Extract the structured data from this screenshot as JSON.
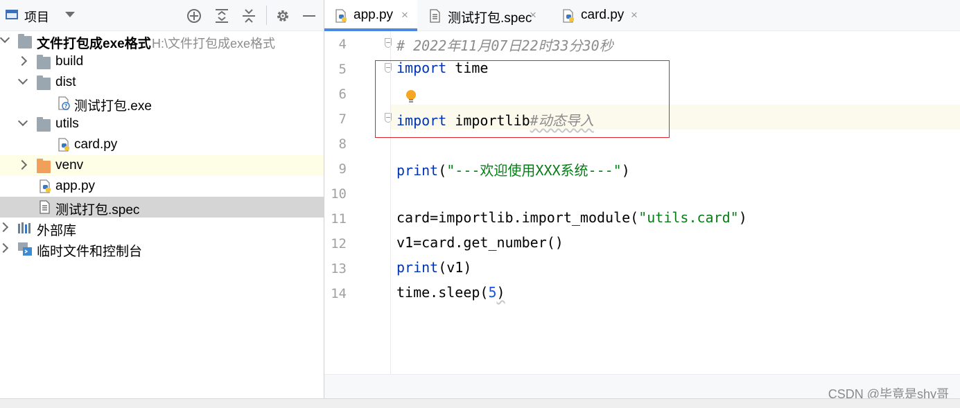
{
  "project_panel": {
    "title": "项目",
    "header_icons": [
      "crosshair-icon",
      "expand-all-icon",
      "collapse-all-icon",
      "gear-icon",
      "minimize-icon"
    ],
    "tree": [
      {
        "label": "文件打包成exe格式",
        "path": "H:\\文件打包成exe格式",
        "type": "root-folder",
        "expanded": true
      },
      {
        "label": "build",
        "type": "folder",
        "expanded": false
      },
      {
        "label": "dist",
        "type": "folder",
        "expanded": true
      },
      {
        "label": "测试打包.exe",
        "type": "exe-file"
      },
      {
        "label": "utils",
        "type": "folder",
        "expanded": true
      },
      {
        "label": "card.py",
        "type": "python-file"
      },
      {
        "label": "venv",
        "type": "folder-orange",
        "expanded": false
      },
      {
        "label": "app.py",
        "type": "python-file"
      },
      {
        "label": "测试打包.spec",
        "type": "text-file",
        "selected": true
      },
      {
        "label": "外部库",
        "type": "external-libs",
        "expanded": false
      },
      {
        "label": "临时文件和控制台",
        "type": "scratches",
        "expanded": false
      }
    ]
  },
  "editor": {
    "tabs": [
      {
        "label": "app.py",
        "active": true,
        "icon": "python-file-icon"
      },
      {
        "label": "测试打包.spec",
        "active": false,
        "icon": "text-file-icon"
      },
      {
        "label": "card.py",
        "active": false,
        "icon": "python-file-icon"
      }
    ],
    "close_glyph": "×",
    "line_numbers": [
      "4",
      "5",
      "6",
      "7",
      "8",
      "9",
      "10",
      "11",
      "12",
      "13",
      "14"
    ],
    "code": {
      "l4": "# 2022年11月07日22时33分30秒",
      "l5_kw": "import",
      "l5_rest": " time",
      "l7_kw": "import",
      "l7_rest": " importlib",
      "l7_cmt": "#动态导入",
      "l9_kw": "print",
      "l9_open": "(",
      "l9_str": "\"---欢迎使用XXX系统---\"",
      "l9_close": ")",
      "l11_pre": "card=importlib.import_module(",
      "l11_str": "\"utils.card\"",
      "l11_post": ")",
      "l12": "v1=card.get_number()",
      "l13_kw": "print",
      "l13_rest": "(v1)",
      "l14_pre": "time.sleep(",
      "l14_num": "5",
      "l14_post": ")"
    }
  },
  "watermark": "CSDN @毕竟是shy哥",
  "colors": {
    "keyword": "#0033b3",
    "string": "#067d17",
    "number": "#1750eb",
    "comment": "#8c8c8c",
    "tab_underline": "#4a88e4",
    "highlight_box": "#e2222a"
  }
}
